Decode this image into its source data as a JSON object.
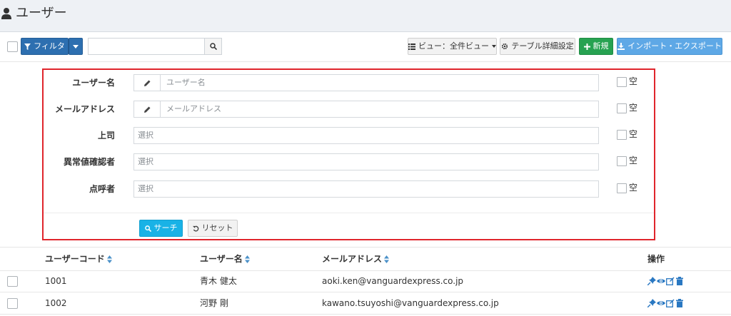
{
  "header": {
    "title": "ユーザー",
    "icon": "user-icon"
  },
  "toolbar": {
    "filter_label": "フィルタ",
    "search": {
      "value": "",
      "placeholder": ""
    },
    "view_label": "ビュー：全件ビュー",
    "table_settings_label": "テーブル詳細設定",
    "new_label": "新規",
    "import_export_label": "インポート・エクスポート"
  },
  "filter": {
    "rows": [
      {
        "label": "ユーザー名",
        "placeholder": "ユーザー名",
        "empty_label": "空"
      },
      {
        "label": "メールアドレス",
        "placeholder": "メールアドレス",
        "empty_label": "空"
      },
      {
        "label": "上司",
        "placeholder": "選択",
        "empty_label": "空"
      },
      {
        "label": "異常値確認者",
        "placeholder": "選択",
        "empty_label": "空"
      },
      {
        "label": "点呼者",
        "placeholder": "選択",
        "empty_label": "空"
      }
    ],
    "search_label": "サーチ",
    "reset_label": "リセット"
  },
  "table": {
    "columns": [
      "ユーザーコード",
      "ユーザー名",
      "メールアドレス",
      "操作"
    ],
    "rows": [
      {
        "code": "1001",
        "name": "青木 健太",
        "email": "aoki.ken@vanguardexpress.co.jp"
      },
      {
        "code": "1002",
        "name": "河野 剛",
        "email": "kawano.tsuyoshi@vanguardexpress.co.jp"
      }
    ]
  },
  "colors": {
    "primary": "#2d6fb0",
    "success": "#27a251",
    "info": "#5ea8e6",
    "search": "#19b2e6",
    "highlight_border": "#e0252c"
  }
}
